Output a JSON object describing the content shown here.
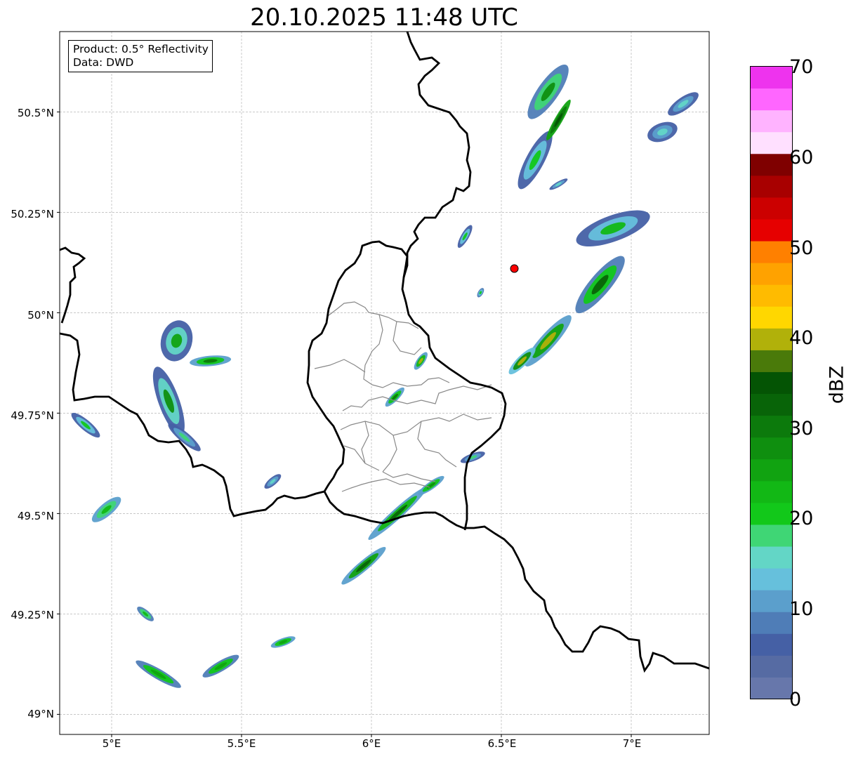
{
  "title": "20.10.2025 11:48 UTC",
  "info": {
    "product": "Product: 0.5° Reflectivity",
    "source": "Data: DWD"
  },
  "axes": {
    "lon_range": [
      4.8,
      7.3
    ],
    "lat_range": [
      48.95,
      50.7
    ],
    "lat_labels": [
      "50.5°N",
      "50.25°N",
      "50°N",
      "49.75°N",
      "49.5°N",
      "49.25°N",
      "49°N"
    ],
    "lon_labels": [
      "5°E",
      "5.5°E",
      "6°E",
      "6.5°E",
      "7°E"
    ],
    "lat_ticks": [
      50.5,
      50.25,
      50.0,
      49.75,
      49.5,
      49.25,
      49.0
    ],
    "lon_ticks": [
      5.0,
      5.5,
      6.0,
      6.5,
      7.0
    ],
    "grid": true
  },
  "radar_site": {
    "lon": 6.55,
    "lat": 50.11,
    "color": "#ff0000"
  },
  "colorbar": {
    "label": "dBZ",
    "min": 0,
    "max": 70,
    "tick_labels": [
      "0",
      "10",
      "20",
      "30",
      "40",
      "50",
      "60",
      "70"
    ],
    "tick_values": [
      0,
      10,
      20,
      30,
      40,
      50,
      60,
      70
    ],
    "colors": [
      "#6777ab",
      "#566ba3",
      "#4560a5",
      "#4f7db7",
      "#5b9fcc",
      "#66c0dc",
      "#63d6c6",
      "#3fd675",
      "#12c81a",
      "#12b815",
      "#11a311",
      "#0f8f0f",
      "#0c7a0c",
      "#086408",
      "#045404",
      "#4a7a0a",
      "#b1b10a",
      "#ffd700",
      "#ffbb00",
      "#ffa200",
      "#ff8000",
      "#e60000",
      "#cc0000",
      "#a80000",
      "#7f0000",
      "#ffe0ff",
      "#ffb3ff",
      "#ff66ff",
      "#ee33ee"
    ]
  },
  "reflectivity_cells": [
    {
      "lon": 6.68,
      "lat": 50.55,
      "len": 0.25,
      "w": 0.08,
      "ang": 55,
      "dbz": [
        8,
        18,
        28
      ]
    },
    {
      "lon": 6.63,
      "lat": 50.38,
      "len": 0.25,
      "w": 0.07,
      "ang": 62,
      "dbz": [
        6,
        14,
        22
      ]
    },
    {
      "lon": 6.72,
      "lat": 50.48,
      "len": 0.18,
      "w": 0.03,
      "ang": 60,
      "dbz": [
        26,
        32,
        36
      ]
    },
    {
      "lon": 6.93,
      "lat": 50.21,
      "len": 0.3,
      "w": 0.1,
      "ang": 20,
      "dbz": [
        6,
        14,
        24
      ]
    },
    {
      "lon": 7.12,
      "lat": 50.45,
      "len": 0.12,
      "w": 0.07,
      "ang": 20,
      "dbz": [
        6,
        10,
        16
      ]
    },
    {
      "lon": 7.2,
      "lat": 50.52,
      "len": 0.14,
      "w": 0.05,
      "ang": 35,
      "dbz": [
        6,
        10,
        16
      ]
    },
    {
      "lon": 6.88,
      "lat": 50.07,
      "len": 0.28,
      "w": 0.08,
      "ang": 50,
      "dbz": [
        8,
        20,
        34
      ]
    },
    {
      "lon": 6.68,
      "lat": 49.93,
      "len": 0.26,
      "w": 0.06,
      "ang": 48,
      "dbz": [
        10,
        26,
        40
      ]
    },
    {
      "lon": 6.58,
      "lat": 49.88,
      "len": 0.14,
      "w": 0.04,
      "ang": 45,
      "dbz": [
        14,
        28,
        42
      ]
    },
    {
      "lon": 6.19,
      "lat": 49.88,
      "len": 0.08,
      "w": 0.03,
      "ang": 55,
      "dbz": [
        12,
        24,
        40
      ]
    },
    {
      "lon": 6.09,
      "lat": 49.79,
      "len": 0.1,
      "w": 0.03,
      "ang": 45,
      "dbz": [
        10,
        20,
        30
      ]
    },
    {
      "lon": 6.1,
      "lat": 49.5,
      "len": 0.3,
      "w": 0.04,
      "ang": 42,
      "dbz": [
        10,
        24,
        34
      ]
    },
    {
      "lon": 5.97,
      "lat": 49.37,
      "len": 0.22,
      "w": 0.04,
      "ang": 40,
      "dbz": [
        12,
        26,
        34
      ]
    },
    {
      "lon": 6.23,
      "lat": 49.57,
      "len": 0.12,
      "w": 0.03,
      "ang": 35,
      "dbz": [
        10,
        20,
        28
      ]
    },
    {
      "lon": 6.39,
      "lat": 49.64,
      "len": 0.1,
      "w": 0.03,
      "ang": 20,
      "dbz": [
        6,
        12,
        18
      ]
    },
    {
      "lon": 5.25,
      "lat": 49.93,
      "len": 0.16,
      "w": 0.12,
      "ang": 75,
      "dbz": [
        6,
        16,
        26
      ]
    },
    {
      "lon": 5.22,
      "lat": 49.78,
      "len": 0.28,
      "w": 0.08,
      "ang": -70,
      "dbz": [
        6,
        16,
        28
      ]
    },
    {
      "lon": 5.38,
      "lat": 49.88,
      "len": 0.16,
      "w": 0.04,
      "ang": 5,
      "dbz": [
        12,
        22,
        30
      ]
    },
    {
      "lon": 5.28,
      "lat": 49.69,
      "len": 0.16,
      "w": 0.04,
      "ang": -40,
      "dbz": [
        6,
        12,
        18
      ]
    },
    {
      "lon": 4.9,
      "lat": 49.72,
      "len": 0.14,
      "w": 0.04,
      "ang": -40,
      "dbz": [
        6,
        14,
        22
      ]
    },
    {
      "lon": 4.98,
      "lat": 49.51,
      "len": 0.14,
      "w": 0.05,
      "ang": 40,
      "dbz": [
        10,
        18,
        24
      ]
    },
    {
      "lon": 5.62,
      "lat": 49.58,
      "len": 0.08,
      "w": 0.03,
      "ang": 40,
      "dbz": [
        6,
        10,
        16
      ]
    },
    {
      "lon": 5.18,
      "lat": 49.1,
      "len": 0.2,
      "w": 0.04,
      "ang": -30,
      "dbz": [
        8,
        20,
        26
      ]
    },
    {
      "lon": 5.42,
      "lat": 49.12,
      "len": 0.16,
      "w": 0.04,
      "ang": 30,
      "dbz": [
        8,
        20,
        26
      ]
    },
    {
      "lon": 5.66,
      "lat": 49.18,
      "len": 0.1,
      "w": 0.03,
      "ang": 20,
      "dbz": [
        10,
        20,
        26
      ]
    },
    {
      "lon": 5.13,
      "lat": 49.25,
      "len": 0.08,
      "w": 0.03,
      "ang": -40,
      "dbz": [
        8,
        18,
        24
      ]
    },
    {
      "lon": 6.72,
      "lat": 50.32,
      "len": 0.08,
      "w": 0.02,
      "ang": 30,
      "dbz": [
        6,
        12,
        16
      ]
    },
    {
      "lon": 6.36,
      "lat": 50.19,
      "len": 0.1,
      "w": 0.03,
      "ang": 60,
      "dbz": [
        6,
        14,
        20
      ]
    },
    {
      "lon": 6.42,
      "lat": 50.05,
      "len": 0.04,
      "w": 0.02,
      "ang": 60,
      "dbz": [
        8,
        14,
        20
      ]
    }
  ]
}
